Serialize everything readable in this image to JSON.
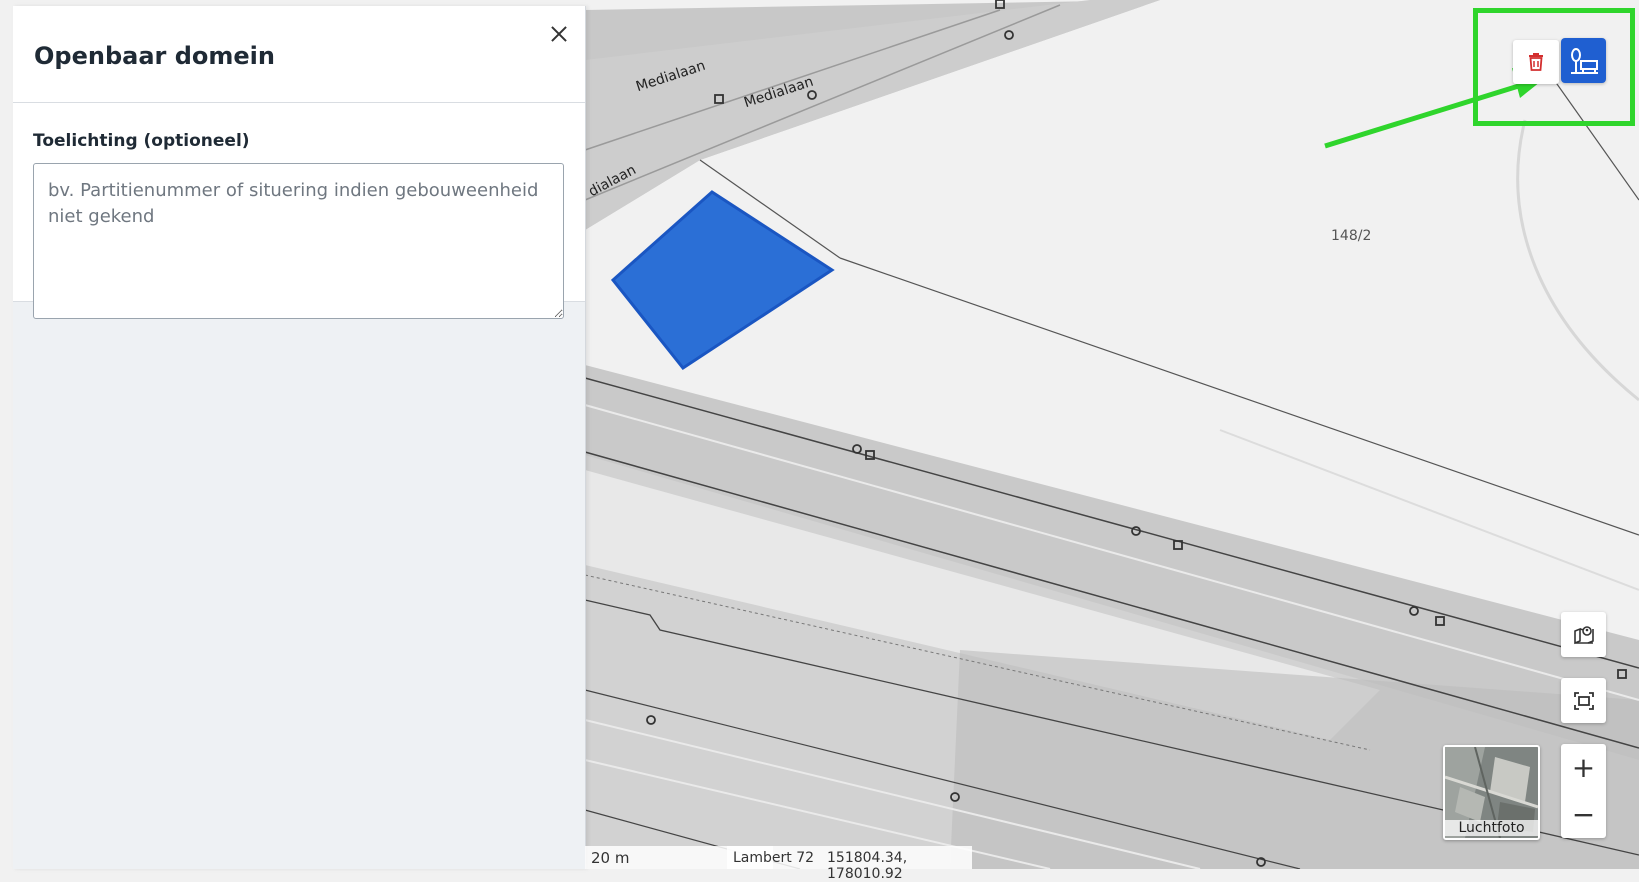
{
  "panel": {
    "title": "Openbaar domein",
    "field_label": "Toelichting (optioneel)",
    "field_placeholder": "bv. Partitienummer of situering indien gebouweenheid niet gekend",
    "field_value": ""
  },
  "map": {
    "street_labels": [
      "Medialaan",
      "Medialaan",
      "dialaan"
    ],
    "parcel_label": "148/2",
    "aerial_label": "Luchtfoto",
    "zoom_in": "+",
    "zoom_out": "−",
    "scale_text": "20 m",
    "projection": "Lambert 72",
    "coordinates": "151804.34, 178010.92",
    "polygon_color": "#2b6fd6",
    "draw_button_color": "#1f5fd1",
    "delete_icon_color": "#d32f2f",
    "annotation_color": "#2fd52c"
  },
  "icons": {
    "close": "close-icon",
    "delete": "trash-icon",
    "draw": "draw-polygon-icon",
    "locate": "locate-address-icon",
    "extent": "zoom-extent-icon"
  }
}
